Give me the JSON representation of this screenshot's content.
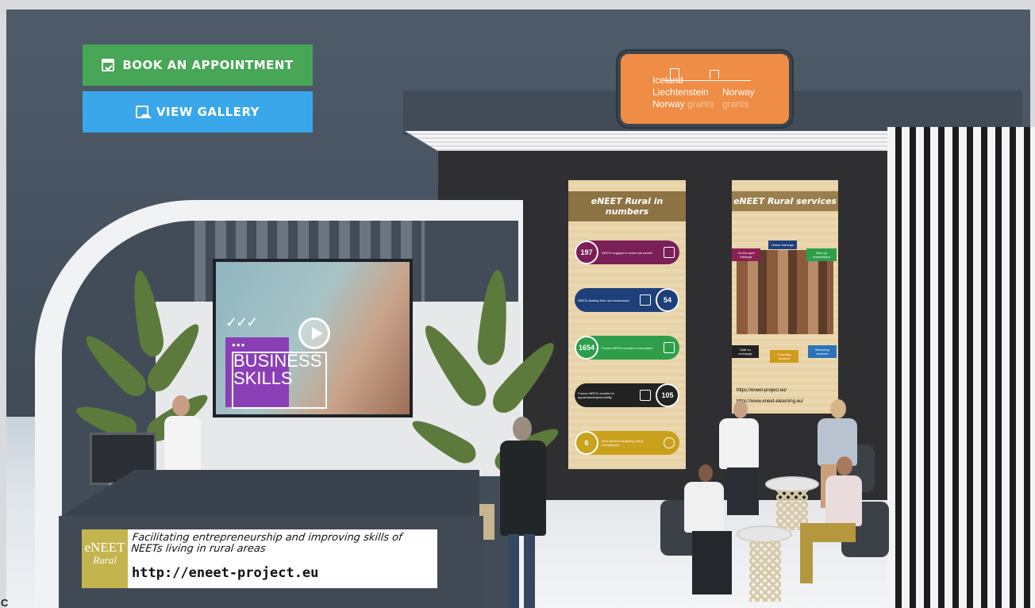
{
  "buttons": {
    "book_label": "BOOK AN APPOINTMENT",
    "gallery_label": "VIEW GALLERY",
    "book_color": "#48a657",
    "gallery_color": "#3aa7ea"
  },
  "grants_sign": {
    "line1": "Iceland",
    "line2_left": "Liechtenstein",
    "line2_right": "Norway",
    "line3_left": "Norway",
    "line3_left_light": "grants",
    "line3_right": "grants",
    "background": "#ef8c45"
  },
  "video": {
    "title_line1": "BUSINESS",
    "title_line2": "SKILLS",
    "checks": "✓✓✓",
    "dots": "●●●"
  },
  "banner_numbers": {
    "title": "eNEET Rural in numbers",
    "stats": [
      {
        "value": "197",
        "text": "NEETs engaged in active job search",
        "color": "#7a1f57"
      },
      {
        "value": "54",
        "text": "NEETs starting their own businesses",
        "color": "#1d3f7a"
      },
      {
        "value": "1654",
        "text": "Former NEETs enrolled in education",
        "color": "#2e9e4a"
      },
      {
        "value": "105",
        "text": "Former NEETs enrolled in apprenticeships/mobility",
        "color": "#222222"
      },
      {
        "value": "6",
        "text": "New services targeting young unemployed",
        "color": "#c9a11c"
      }
    ]
  },
  "banner_services": {
    "title": "eNEET Rural services",
    "services": [
      {
        "label": "On-the-spot trainings",
        "color": "#8b1f55"
      },
      {
        "label": "Online trainings",
        "color": "#1f3f7a"
      },
      {
        "label": "Start-up competitions",
        "color": "#2e9e4a"
      },
      {
        "label": "Staff on exchange",
        "color": "#222222"
      },
      {
        "label": "Coaching services",
        "color": "#d39a1d"
      },
      {
        "label": "Mentoring services",
        "color": "#2a73b8"
      }
    ],
    "url1": "https://eneet-project.eu/",
    "url2": "https://www.eneet-elearning.eu/"
  },
  "info_bar": {
    "logo_top": "eNEET",
    "logo_bottom": "Rural",
    "tagline": "Facilitating entrepreneurship and improving skills of NEETs living in rural areas",
    "website": "http://eneet-project.eu"
  },
  "corner_mark": "C"
}
